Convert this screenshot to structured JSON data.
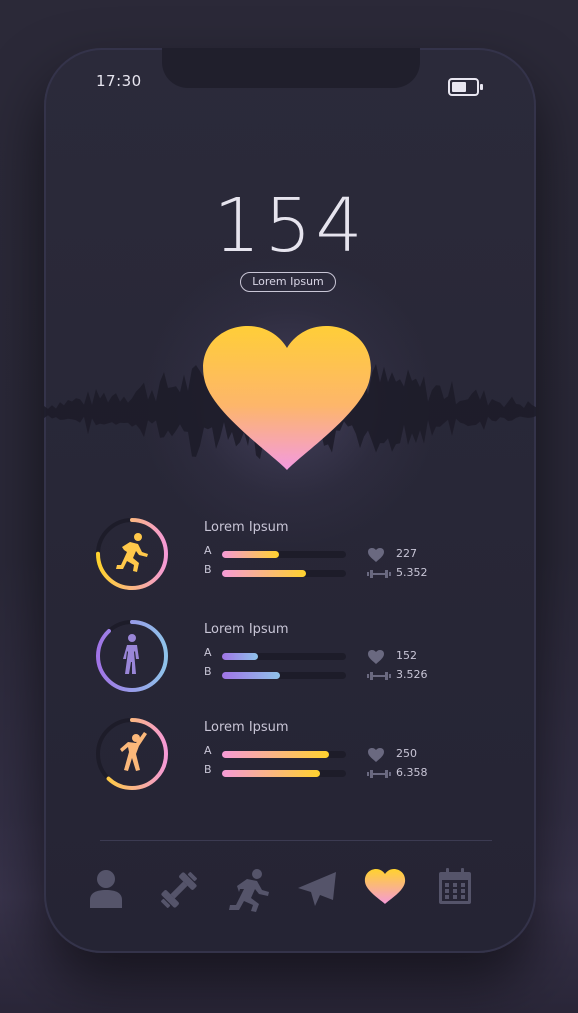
{
  "status_bar": {
    "time": "17:30"
  },
  "heart_rate": {
    "value": "154",
    "label": "Lorem Ipsum"
  },
  "activities": [
    {
      "name": "running",
      "title": "Lorem Ipsum",
      "bar_a_label": "A",
      "bar_b_label": "B",
      "bar_a_fraction": 0.46,
      "bar_b_fraction": 0.68,
      "ring_fraction": 0.75,
      "heart_value": "227",
      "weight_value": "5.352"
    },
    {
      "name": "walking",
      "title": "Lorem Ipsum",
      "bar_a_label": "A",
      "bar_b_label": "B",
      "bar_a_fraction": 0.29,
      "bar_b_fraction": 0.47,
      "ring_fraction": 0.88,
      "heart_value": "152",
      "weight_value": "3.526"
    },
    {
      "name": "stretching",
      "title": "Lorem Ipsum",
      "bar_a_label": "A",
      "bar_b_label": "B",
      "bar_a_fraction": 0.86,
      "bar_b_fraction": 0.79,
      "ring_fraction": 0.62,
      "heart_value": "250",
      "weight_value": "6.358"
    }
  ],
  "bottom_nav": {
    "items": [
      "profile-icon",
      "dumbbell-icon",
      "running-icon",
      "send-icon",
      "heart-icon",
      "calendar-icon"
    ],
    "active": "heart-icon"
  },
  "colors": {
    "gradient_yellow": "#ffd22e",
    "gradient_pink": "#f59ad6",
    "purple": "#a074e6",
    "blue": "#8fc3ea",
    "nav_inactive": "#55546a"
  }
}
